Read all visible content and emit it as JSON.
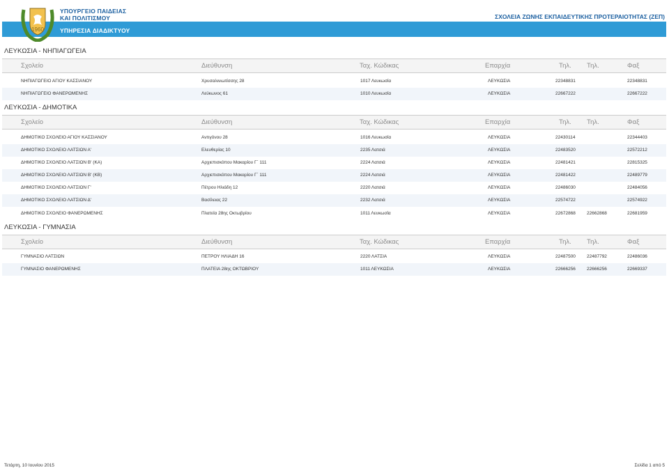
{
  "header": {
    "ministry_line1": "ΥΠΟΥΡΓΕΙΟ ΠΑΙΔΕΙΑΣ",
    "ministry_line2": "ΚΑΙ ΠΟΛΙΤΙΣΜΟΥ",
    "ministry_line3": "ΥΠΗΡΕΣΙΑ ΔΙΑΔΙΚΤΥΟΥ",
    "right_title": "ΣΧΟΛΕΙΑ ΖΩΝΗΣ ΕΚΠΑΙΔΕΥΤΙΚΗΣ ΠΡΟΤΕΡΑΙΟΤΗΤΑΣ (ΖΕΠ)",
    "banner_color": "#2f9bd6"
  },
  "columns": [
    "Σχολείο",
    "Διεύθυνση",
    "Ταχ. Κώδικας",
    "Επαρχία",
    "Τηλ.",
    "Τηλ.",
    "Φαξ"
  ],
  "sections": [
    {
      "title": "ΛΕΥΚΩΣΙΑ - ΝΗΠΙΑΓΩΓΕΙΑ",
      "rows": [
        [
          "ΝΗΠΙΑΓΩΓΕΙΟ ΑΓΙΟΥ ΚΑΣΣΙΑΝΟΥ",
          "Χρυσαλινιωτίσσης 28",
          "1017 Λευκωσία",
          "ΛΕΥΚΩΣΙΑ",
          "22348831",
          "",
          "22348831"
        ],
        [
          "ΝΗΠΙΑΓΩΓΕΙΟ ΦΑΝΕΡΩΜΕΝΗΣ",
          "Λεύκωνος 61",
          "1010 Λευκωσία",
          "ΛΕΥΚΩΣΙΑ",
          "22667222",
          "",
          "22667222"
        ]
      ]
    },
    {
      "title": "ΛΕΥΚΩΣΙΑ - ΔΗΜΟΤΙΚΑ",
      "rows": [
        [
          "ΔΗΜΟΤΙΚΟ ΣΧΟΛΕΙΟ ΑΓΙΟΥ ΚΑΣΣΙΑΝΟΥ",
          "Αντιγόνου 28",
          "1016 Λευκωσία",
          "ΛΕΥΚΩΣΙΑ",
          "22430114",
          "",
          "22344403"
        ],
        [
          "ΔΗΜΟΤΙΚΟ ΣΧΟΛΕΙΟ ΛΑΤΣΙΩΝ Α'",
          "Ελευθερίας 10",
          "2235 Λατσιά",
          "ΛΕΥΚΩΣΙΑ",
          "22483520",
          "",
          "22572212"
        ],
        [
          "ΔΗΜΟΤΙΚΟ ΣΧΟΛΕΙΟ ΛΑΤΣΙΩΝ Β' (ΚΑ)",
          "Αρχιεπισκόπου Μακαρίου Γ΄ 111",
          "2224 Λατσιά",
          "ΛΕΥΚΩΣΙΑ",
          "22481421",
          "",
          "22815325"
        ],
        [
          "ΔΗΜΟΤΙΚΟ ΣΧΟΛΕΙΟ ΛΑΤΣΙΩΝ Β' (ΚΒ)",
          "Αρχιεπισκόπου Μακαρίου Γ΄ 111",
          "2224 Λατσιά",
          "ΛΕΥΚΩΣΙΑ",
          "22481422",
          "",
          "22489779"
        ],
        [
          "ΔΗΜΟΤΙΚΟ ΣΧΟΛΕΙΟ ΛΑΤΣΙΩΝ Γ'",
          "Πέτρου Ηλιάδη 12",
          "2220 Λατσιά",
          "ΛΕΥΚΩΣΙΑ",
          "22486030",
          "",
          "22484056"
        ],
        [
          "ΔΗΜΟΤΙΚΟ ΣΧΟΛΕΙΟ ΛΑΤΣΙΩΝ Δ'",
          "Βασίλειας 22",
          "2232 Λατσιά",
          "ΛΕΥΚΩΣΙΑ",
          "22574722",
          "",
          "22574922"
        ],
        [
          "ΔΗΜΟΤΙΚΟ ΣΧΟΛΕΙΟ ΦΑΝΕΡΩΜΕΝΗΣ",
          "Πλατεία 28ης Οκτωβρίου",
          "1011 Λευκωσία",
          "ΛΕΥΚΩΣΙΑ",
          "22672868",
          "22662868",
          "22681959"
        ]
      ]
    },
    {
      "title": "ΛΕΥΚΩΣΙΑ - ΓΥΜΝΑΣΙΑ",
      "rows": [
        [
          "ΓΥΜΝΑΣΙΟ ΛΑΤΣΙΩΝ",
          "ΠΕΤΡΟΥ ΗΛΙΑΔΗ 16",
          "2220 ΛΑΤΣΙΑ",
          "ΛΕΥΚΩΣΙΑ",
          "22487500",
          "22487792",
          "22486036"
        ],
        [
          "ΓΥΜΝΑΣΙΟ ΦΑΝΕΡΩΜΕΝΗΣ",
          "ΠΛΑΤΕΙΑ 28ης ΟΚΤΩΒΡΙΟΥ",
          "1011 ΛΕΥΚΩΣΙΑ",
          "ΛΕΥΚΩΣΙΑ",
          "22666256",
          "22666256",
          "22669337"
        ]
      ]
    }
  ],
  "footer": {
    "date": "Τετάρτη, 10 Ιουνίου 2015",
    "page": "Σελίδα 1 από 5"
  },
  "icons": {
    "logo": "cyprus-coat-of-arms-icon"
  }
}
